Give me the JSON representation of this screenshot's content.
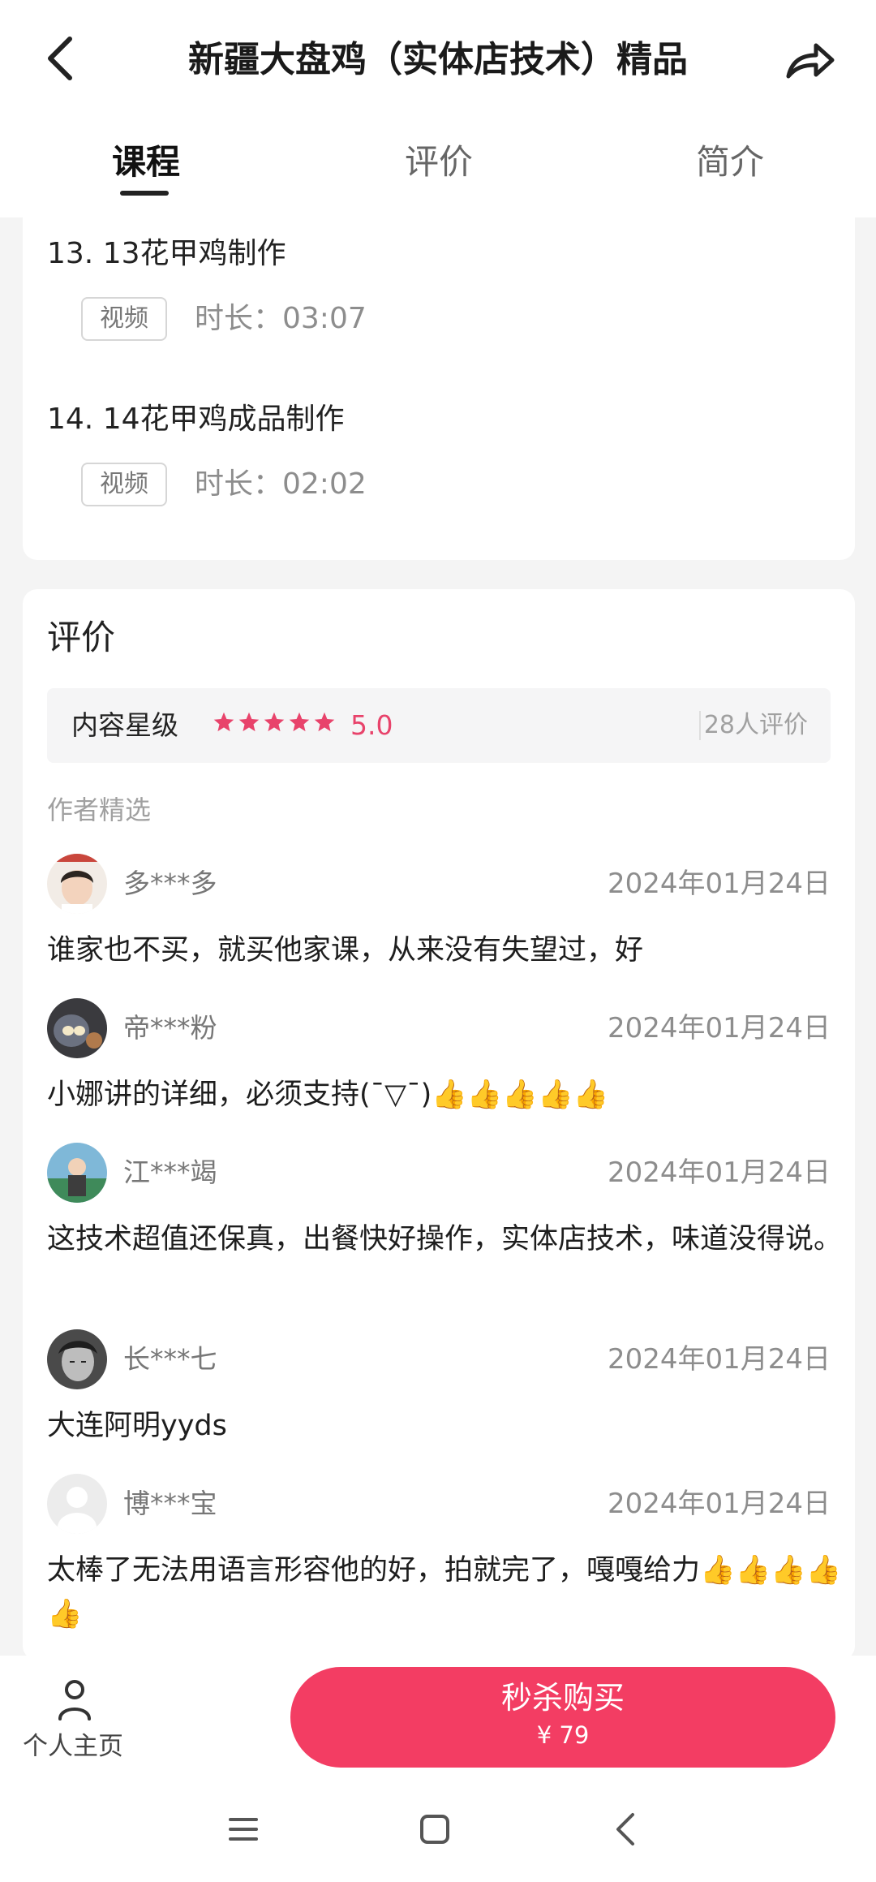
{
  "header": {
    "title": "新疆大盘鸡（实体店技术）精品",
    "back_icon": "chevron-left-icon",
    "share_icon": "share-arrow-icon"
  },
  "tabs": [
    {
      "label": "课程",
      "active": true
    },
    {
      "label": "评价",
      "active": false
    },
    {
      "label": "简介",
      "active": false
    }
  ],
  "lessons": [
    {
      "title": "13. 13花甲鸡制作",
      "tag": "视频",
      "duration": "时长：03:07"
    },
    {
      "title": "14. 14花甲鸡成品制作",
      "tag": "视频",
      "duration": "时长：02:02"
    }
  ],
  "reviews_section": {
    "title": "评价",
    "rating_label": "内容星级",
    "stars": 5,
    "score": "5.0",
    "count": "28人评价",
    "picked_label": "作者精选",
    "accent_color": "#e8436b"
  },
  "reviews": [
    {
      "name": "多***多",
      "date": "2024年01月24日",
      "text": "谁家也不买，就买他家课，从来没有失望过，好"
    },
    {
      "name": "帝***粉",
      "date": "2024年01月24日",
      "text": "小娜讲的详细，必须支持(ˉ▽ˉ)👍👍👍👍👍"
    },
    {
      "name": "江***竭",
      "date": "2024年01月24日",
      "text": "这技术超值还保真，出餐快好操作，实体店技术，味道没得说。"
    },
    {
      "name": "长***七",
      "date": "2024年01月24日",
      "text": "大连阿明yyds"
    },
    {
      "name": "博***宝",
      "date": "2024年01月24日",
      "text": "太棒了无法用语言形容他的好，拍就完了，嘎嘎给力👍👍👍👍👍"
    }
  ],
  "bottom_bar": {
    "profile_label": "个人主页",
    "buy_label": "秒杀购买",
    "buy_price": "¥ 79",
    "buy_color": "#f33d63"
  }
}
